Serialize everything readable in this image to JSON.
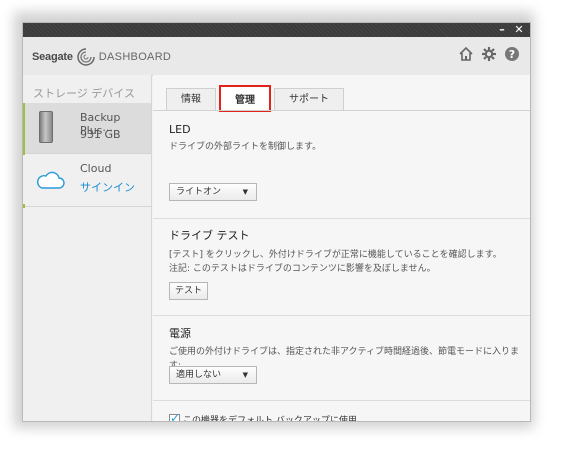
{
  "window": {
    "minimize_glyph": "–",
    "close_glyph": "✕"
  },
  "header": {
    "brand_name": "Seagate",
    "product_name": "DASHBOARD",
    "icons": [
      "home-icon",
      "gear-icon",
      "help-icon"
    ]
  },
  "sidebar": {
    "title": "ストレージ デバイス",
    "devices": [
      {
        "name": "Backup Plus···",
        "detail": "931 GB",
        "icon": "external-drive-icon"
      },
      {
        "name": "Cloud",
        "detail": "サインイン",
        "icon": "cloud-icon"
      }
    ],
    "accent": "#9fbf3f"
  },
  "tabs": [
    {
      "label": "情報",
      "active": false
    },
    {
      "label": "管理",
      "active": true
    },
    {
      "label": "サポート",
      "active": false
    }
  ],
  "sections": {
    "led": {
      "title": "LED",
      "desc": "ドライブの外部ライトを制御します。",
      "dropdown_value": "ライトオン"
    },
    "drive_test": {
      "title": "ドライブ テスト",
      "desc1": "[テスト] をクリックし、外付けドライブが正常に機能していることを確認します。",
      "desc2": "注記: このテストはドライブのコンテンツに影響を及ぼしません。",
      "button": "テスト"
    },
    "power": {
      "title": "電源",
      "desc": "ご使用の外付けドライブは、指定された非アクティブ時間経過後、節電モードに入ります:",
      "dropdown_value": "適用しない"
    },
    "default_backup": {
      "label": "この機器をデフォルト バックアップに使用",
      "checked": true
    }
  },
  "colors": {
    "link": "#1a8fd1",
    "active_tab_outline": "#e2231a"
  }
}
